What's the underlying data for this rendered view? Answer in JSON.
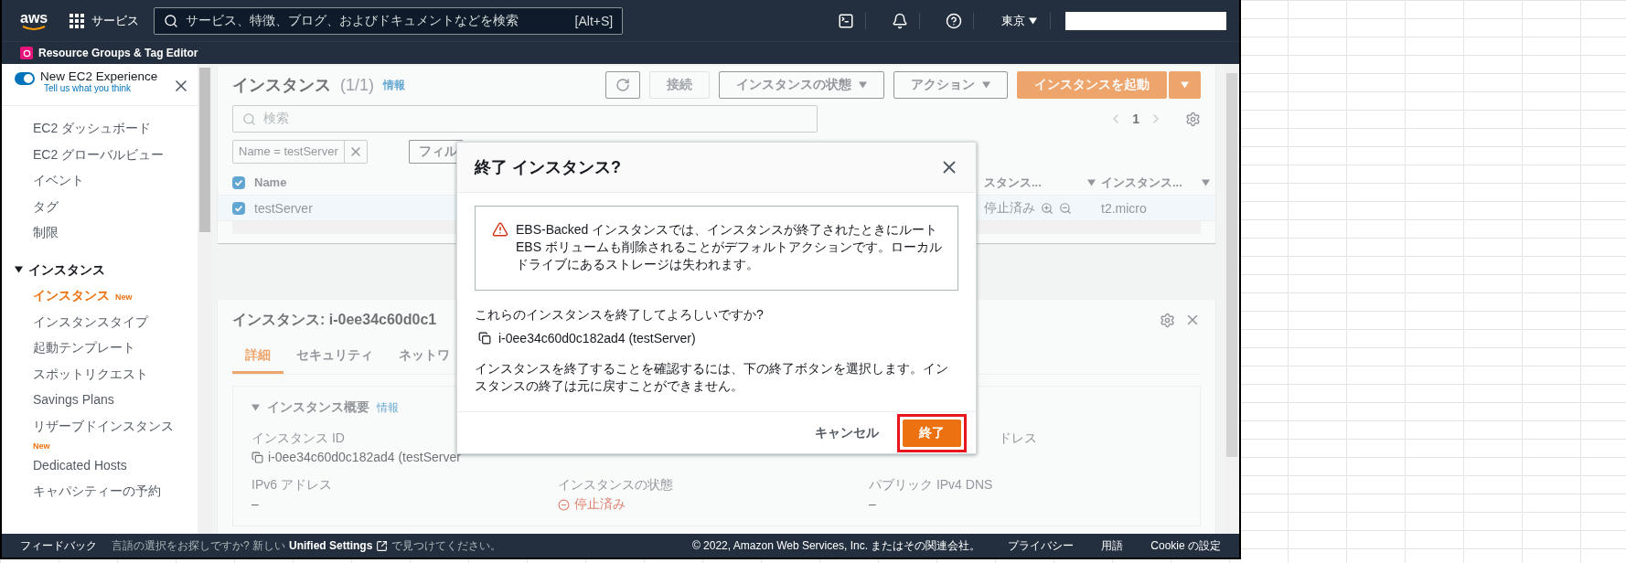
{
  "top_bar": {
    "logo": "aws",
    "services": "サービス",
    "search": {
      "placeholder": "サービス、特徴、ブログ、およびドキュメントなどを検索",
      "shortcut": "[Alt+S]"
    },
    "region": "東京"
  },
  "sub_bar": {
    "label": "Resource Groups & Tag Editor"
  },
  "sidebar": {
    "toggle": {
      "label": "New EC2 Experience",
      "on": true
    },
    "feedback_link": "Tell us what you think",
    "items": [
      {
        "label": "EC2 ダッシュボード",
        "selected": false
      },
      {
        "label": "EC2 グローバルビュー",
        "selected": false
      },
      {
        "label": "イベント",
        "selected": false
      },
      {
        "label": "タグ",
        "selected": false
      },
      {
        "label": "制限",
        "selected": false
      }
    ],
    "section": {
      "label": "インスタンス",
      "expanded": true,
      "items": [
        {
          "label": "インスタンス",
          "selected": true,
          "badge": "New"
        },
        {
          "label": "インスタンスタイプ",
          "selected": false
        },
        {
          "label": "起動テンプレート",
          "selected": false
        },
        {
          "label": "スポットリクエスト",
          "selected": false
        },
        {
          "label": "Savings Plans",
          "selected": false
        },
        {
          "label": "リザーブドインスタンス",
          "selected": false,
          "badge": "New"
        },
        {
          "label": "Dedicated Hosts",
          "selected": false
        },
        {
          "label": "キャパシティーの予約",
          "selected": false
        }
      ]
    }
  },
  "instances_panel": {
    "title": "インスタンス",
    "count": "(1/1)",
    "info": "情報",
    "buttons": [
      {
        "kind": "refresh"
      },
      {
        "kind": "plain",
        "label": "接続"
      },
      {
        "kind": "dropdown",
        "label": "インスタンスの状態"
      },
      {
        "kind": "dropdown",
        "label": "アクション"
      },
      {
        "kind": "primary",
        "label": "インスタンスを起動"
      },
      {
        "kind": "caret"
      }
    ],
    "search": {
      "placeholder": "検索"
    },
    "page": "1",
    "filter": {
      "token": "Name = testServer",
      "button": "フィル"
    },
    "select_all": {
      "checked": true
    },
    "columns": [
      "Name",
      "スタンス...",
      "インスタンス..."
    ],
    "rows": [
      {
        "checked": true,
        "name": "testServer",
        "state": "停止済み",
        "type": "t2.micro"
      }
    ]
  },
  "details_panel": {
    "title": "インスタンス: i-0ee34c60d0c1",
    "tabs": [
      {
        "label": "詳細",
        "selected": true
      },
      {
        "label": "セキュリティ",
        "selected": false
      },
      {
        "label": "ネットワ",
        "selected": false
      }
    ],
    "section": {
      "label": "インスタンス概要",
      "info": "情報",
      "expanded": true
    },
    "fields": [
      {
        "kind": "copy",
        "label": "インスタンス ID",
        "value": "i-0ee34c60d0c182ad4 (testServer"
      },
      {
        "kind": "clipped",
        "label": "ドレス"
      },
      {
        "kind": "plain",
        "label": "IPv6 アドレス",
        "value": "–"
      },
      {
        "kind": "status",
        "label": "インスタンスの状態",
        "value": "停止済み"
      },
      {
        "kind": "plain",
        "label": "パブリック IPv4 DNS",
        "value": "–"
      }
    ]
  },
  "modal": {
    "title": "終了 インスタンス?",
    "alert": "EBS-Backed インスタンスでは、インスタンスが終了されたときにルート EBS ボリュームも削除されることがデフォルトアクションです。ローカルドライブにあるストレージは失われます。",
    "question": "これらのインスタンスを終了してよろしいですか?",
    "instance": "i-0ee34c60d0c182ad4 (testServer)",
    "note": "インスタンスを終了することを確認するには、下の終了ボタンを選択します。インスタンスの終了は元に戻すことができません。",
    "cancel": "キャンセル",
    "confirm": "終了",
    "confirm_highlighted": true
  },
  "footer": {
    "feedback": "フィードバック",
    "notice_before": "言語の選択をお探しですか? 新しい",
    "notice_link": "Unified Settings",
    "notice_after": "で見つけてください。",
    "copyright": "© 2022, Amazon Web Services, Inc. またはその関連会社。",
    "links": [
      "プライバシー",
      "用語",
      "Cookie の設定"
    ]
  }
}
